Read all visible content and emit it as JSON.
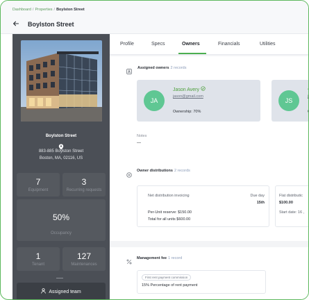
{
  "breadcrumb": {
    "items": [
      "Dashboard",
      "Properties",
      "Boylston Street"
    ]
  },
  "header": {
    "title": "Boylston Street"
  },
  "property": {
    "name": "Boylston Street",
    "address_line1": "883-885 Boylston Street",
    "address_line2": "Boston, MA, 02116, US"
  },
  "stats": {
    "equipment": {
      "value": "7",
      "label": "Equipment"
    },
    "recurring": {
      "value": "3",
      "label": "Recurring requests"
    },
    "occupancy": {
      "value": "50%",
      "label": "Occupancy",
      "fraction": 0.5
    },
    "tenant": {
      "value": "1",
      "label": "Tenant"
    },
    "maintenances": {
      "value": "127",
      "label": "Maintenances"
    }
  },
  "sidebar": {
    "team_button_label": "Assigned team"
  },
  "tabs": [
    {
      "label": "Profile",
      "active": false
    },
    {
      "label": "Specs",
      "active": false
    },
    {
      "label": "Owners",
      "active": true
    },
    {
      "label": "Financials",
      "active": false
    },
    {
      "label": "Utilities",
      "active": false
    }
  ],
  "owners_section": {
    "title": "Assigned owners",
    "count": "2 records",
    "owners": [
      {
        "initials": "JA",
        "name": "Jason Avery",
        "email": "jason@gmail.com",
        "ownership": "Ownership: 70%"
      },
      {
        "initials": "JS",
        "name": "J",
        "email": "j",
        "ownership": "O"
      }
    ],
    "notes_label": "Notes",
    "notes_value": "—"
  },
  "distributions_section": {
    "title": "Owner distributions",
    "count": "2 records",
    "card1": {
      "type_label": "Net distribution invoicing",
      "due_label": "Due day",
      "due_value": "15th",
      "per_unit": "Per-Unit reserve: $150.00",
      "total": "Total for all units $600.00"
    },
    "card2": {
      "type_label": "Flat distributic",
      "amount": "$100.00",
      "start": "Start date: 16 ,"
    }
  },
  "fee_section": {
    "title": "Management fee",
    "count": "1 record",
    "pill": "First rent payment commission",
    "description": "15% Percentage of rent payment"
  },
  "colors": {
    "accent_green": "#4caf50",
    "sidebar_bg": "#4b4f56",
    "avatar_green": "#5fc793",
    "owner_card_bg": "#dfe3ea"
  }
}
